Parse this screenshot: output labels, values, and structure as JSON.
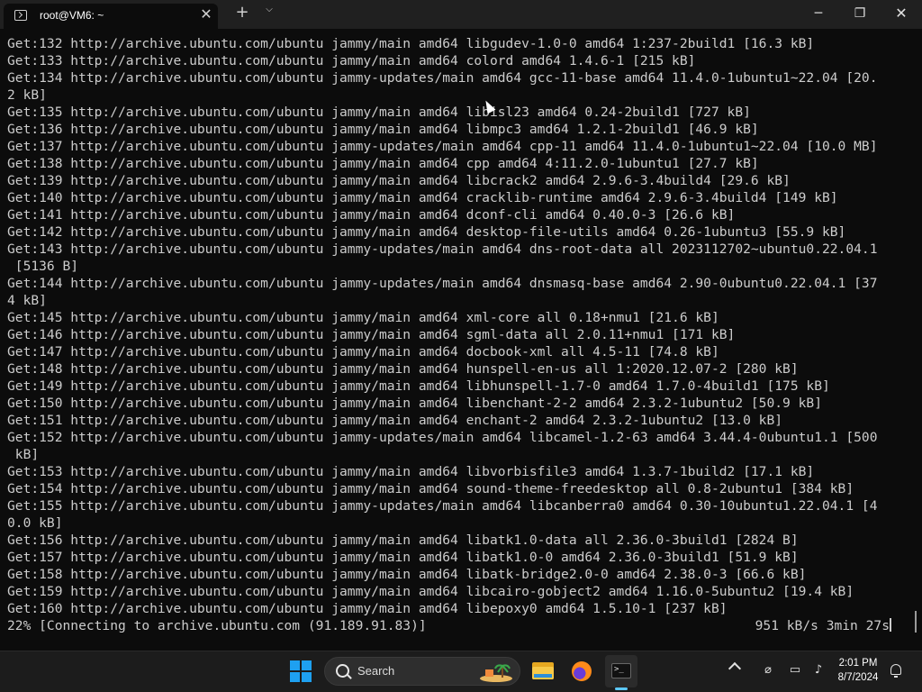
{
  "window": {
    "tab_title": "root@VM6: ~",
    "tab_close_glyph": "✕",
    "new_tab_glyph": "+",
    "dropdown_glyph": "⌵",
    "minimize_glyph": "─",
    "maximize_glyph": "❐",
    "close_glyph": "✕"
  },
  "terminal": {
    "lines": [
      "Get:132 http://archive.ubuntu.com/ubuntu jammy/main amd64 libgudev-1.0-0 amd64 1:237-2build1 [16.3 kB]",
      "Get:133 http://archive.ubuntu.com/ubuntu jammy/main amd64 colord amd64 1.4.6-1 [215 kB]",
      "Get:134 http://archive.ubuntu.com/ubuntu jammy-updates/main amd64 gcc-11-base amd64 11.4.0-1ubuntu1~22.04 [20.",
      "2 kB]",
      "Get:135 http://archive.ubuntu.com/ubuntu jammy/main amd64 libisl23 amd64 0.24-2build1 [727 kB]",
      "Get:136 http://archive.ubuntu.com/ubuntu jammy/main amd64 libmpc3 amd64 1.2.1-2build1 [46.9 kB]",
      "Get:137 http://archive.ubuntu.com/ubuntu jammy-updates/main amd64 cpp-11 amd64 11.4.0-1ubuntu1~22.04 [10.0 MB]",
      "Get:138 http://archive.ubuntu.com/ubuntu jammy/main amd64 cpp amd64 4:11.2.0-1ubuntu1 [27.7 kB]",
      "Get:139 http://archive.ubuntu.com/ubuntu jammy/main amd64 libcrack2 amd64 2.9.6-3.4build4 [29.6 kB]",
      "Get:140 http://archive.ubuntu.com/ubuntu jammy/main amd64 cracklib-runtime amd64 2.9.6-3.4build4 [149 kB]",
      "Get:141 http://archive.ubuntu.com/ubuntu jammy/main amd64 dconf-cli amd64 0.40.0-3 [26.6 kB]",
      "Get:142 http://archive.ubuntu.com/ubuntu jammy/main amd64 desktop-file-utils amd64 0.26-1ubuntu3 [55.9 kB]",
      "Get:143 http://archive.ubuntu.com/ubuntu jammy-updates/main amd64 dns-root-data all 2023112702~ubuntu0.22.04.1",
      " [5136 B]",
      "Get:144 http://archive.ubuntu.com/ubuntu jammy-updates/main amd64 dnsmasq-base amd64 2.90-0ubuntu0.22.04.1 [37",
      "4 kB]",
      "Get:145 http://archive.ubuntu.com/ubuntu jammy/main amd64 xml-core all 0.18+nmu1 [21.6 kB]",
      "Get:146 http://archive.ubuntu.com/ubuntu jammy/main amd64 sgml-data all 2.0.11+nmu1 [171 kB]",
      "Get:147 http://archive.ubuntu.com/ubuntu jammy/main amd64 docbook-xml all 4.5-11 [74.8 kB]",
      "Get:148 http://archive.ubuntu.com/ubuntu jammy/main amd64 hunspell-en-us all 1:2020.12.07-2 [280 kB]",
      "Get:149 http://archive.ubuntu.com/ubuntu jammy/main amd64 libhunspell-1.7-0 amd64 1.7.0-4build1 [175 kB]",
      "Get:150 http://archive.ubuntu.com/ubuntu jammy/main amd64 libenchant-2-2 amd64 2.3.2-1ubuntu2 [50.9 kB]",
      "Get:151 http://archive.ubuntu.com/ubuntu jammy/main amd64 enchant-2 amd64 2.3.2-1ubuntu2 [13.0 kB]",
      "Get:152 http://archive.ubuntu.com/ubuntu jammy-updates/main amd64 libcamel-1.2-63 amd64 3.44.4-0ubuntu1.1 [500",
      " kB]",
      "Get:153 http://archive.ubuntu.com/ubuntu jammy/main amd64 libvorbisfile3 amd64 1.3.7-1build2 [17.1 kB]",
      "Get:154 http://archive.ubuntu.com/ubuntu jammy/main amd64 sound-theme-freedesktop all 0.8-2ubuntu1 [384 kB]",
      "Get:155 http://archive.ubuntu.com/ubuntu jammy-updates/main amd64 libcanberra0 amd64 0.30-10ubuntu1.22.04.1 [4",
      "0.0 kB]",
      "Get:156 http://archive.ubuntu.com/ubuntu jammy/main amd64 libatk1.0-data all 2.36.0-3build1 [2824 B]",
      "Get:157 http://archive.ubuntu.com/ubuntu jammy/main amd64 libatk1.0-0 amd64 2.36.0-3build1 [51.9 kB]",
      "Get:158 http://archive.ubuntu.com/ubuntu jammy/main amd64 libatk-bridge2.0-0 amd64 2.38.0-3 [66.6 kB]",
      "Get:159 http://archive.ubuntu.com/ubuntu jammy/main amd64 libcairo-gobject2 amd64 1.16.0-5ubuntu2 [19.4 kB]",
      "Get:160 http://archive.ubuntu.com/ubuntu jammy/main amd64 libepoxy0 amd64 1.5.10-1 [237 kB]"
    ],
    "status_left": "22% [Connecting to archive.ubuntu.com (91.189.91.83)]",
    "status_right": "951 kB/s 3min 27s"
  },
  "taskbar": {
    "search_label": "Search",
    "tray_wifi_glyph": "⌀",
    "tray_monitor_glyph": "▭",
    "tray_volume_glyph": "♪",
    "clock_time": "2:01 PM",
    "clock_date": "8/7/2024"
  }
}
